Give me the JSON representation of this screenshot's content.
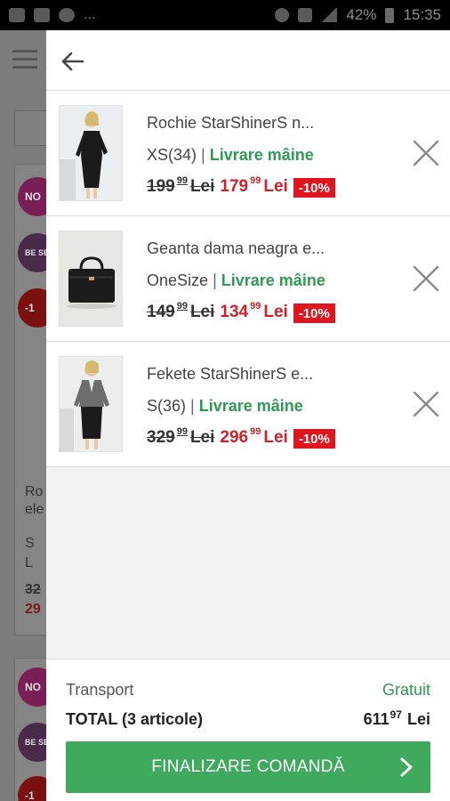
{
  "status_bar": {
    "battery": "42%",
    "time": "15:35",
    "overflow": "..."
  },
  "background_page": {
    "badges": [
      "NO",
      "BE SEL",
      "-1"
    ],
    "product_title_lines": [
      "Ro",
      "ele"
    ],
    "sizes": [
      "S",
      "L"
    ],
    "old_price": "32",
    "new_price": "29"
  },
  "cart": {
    "items": [
      {
        "name": "Rochie StarShinerS n...",
        "size": "XS(34)",
        "delivery": "Livrare mâine",
        "old_price": "199",
        "old_price_cents": "99",
        "new_price": "179",
        "new_price_cents": "99",
        "currency": "Lei",
        "discount": "-10%"
      },
      {
        "name": "Geanta dama neagra e...",
        "size": "OneSize",
        "delivery": "Livrare mâine",
        "old_price": "149",
        "old_price_cents": "99",
        "new_price": "134",
        "new_price_cents": "99",
        "currency": "Lei",
        "discount": "-10%"
      },
      {
        "name": "Fekete StarShinerS e...",
        "size": "S(36)",
        "delivery": "Livrare mâine",
        "old_price": "329",
        "old_price_cents": "99",
        "new_price": "296",
        "new_price_cents": "99",
        "currency": "Lei",
        "discount": "-10%"
      }
    ],
    "separator": "|"
  },
  "summary": {
    "transport_label": "Transport",
    "transport_value": "Gratuit",
    "total_label": "TOTAL (3 articole)",
    "total_value": "611",
    "total_cents": "97",
    "total_currency": "Lei",
    "checkout_label": "FINALIZARE COMANDĂ"
  },
  "colors": {
    "accent_green": "#3faa5e",
    "delivery_green": "#2e9a55",
    "price_red": "#d0202a",
    "discount_red": "#e0141e"
  },
  "icons": {
    "back": "arrow-left-icon",
    "remove": "close-icon",
    "checkout": "chevron-right-icon"
  }
}
